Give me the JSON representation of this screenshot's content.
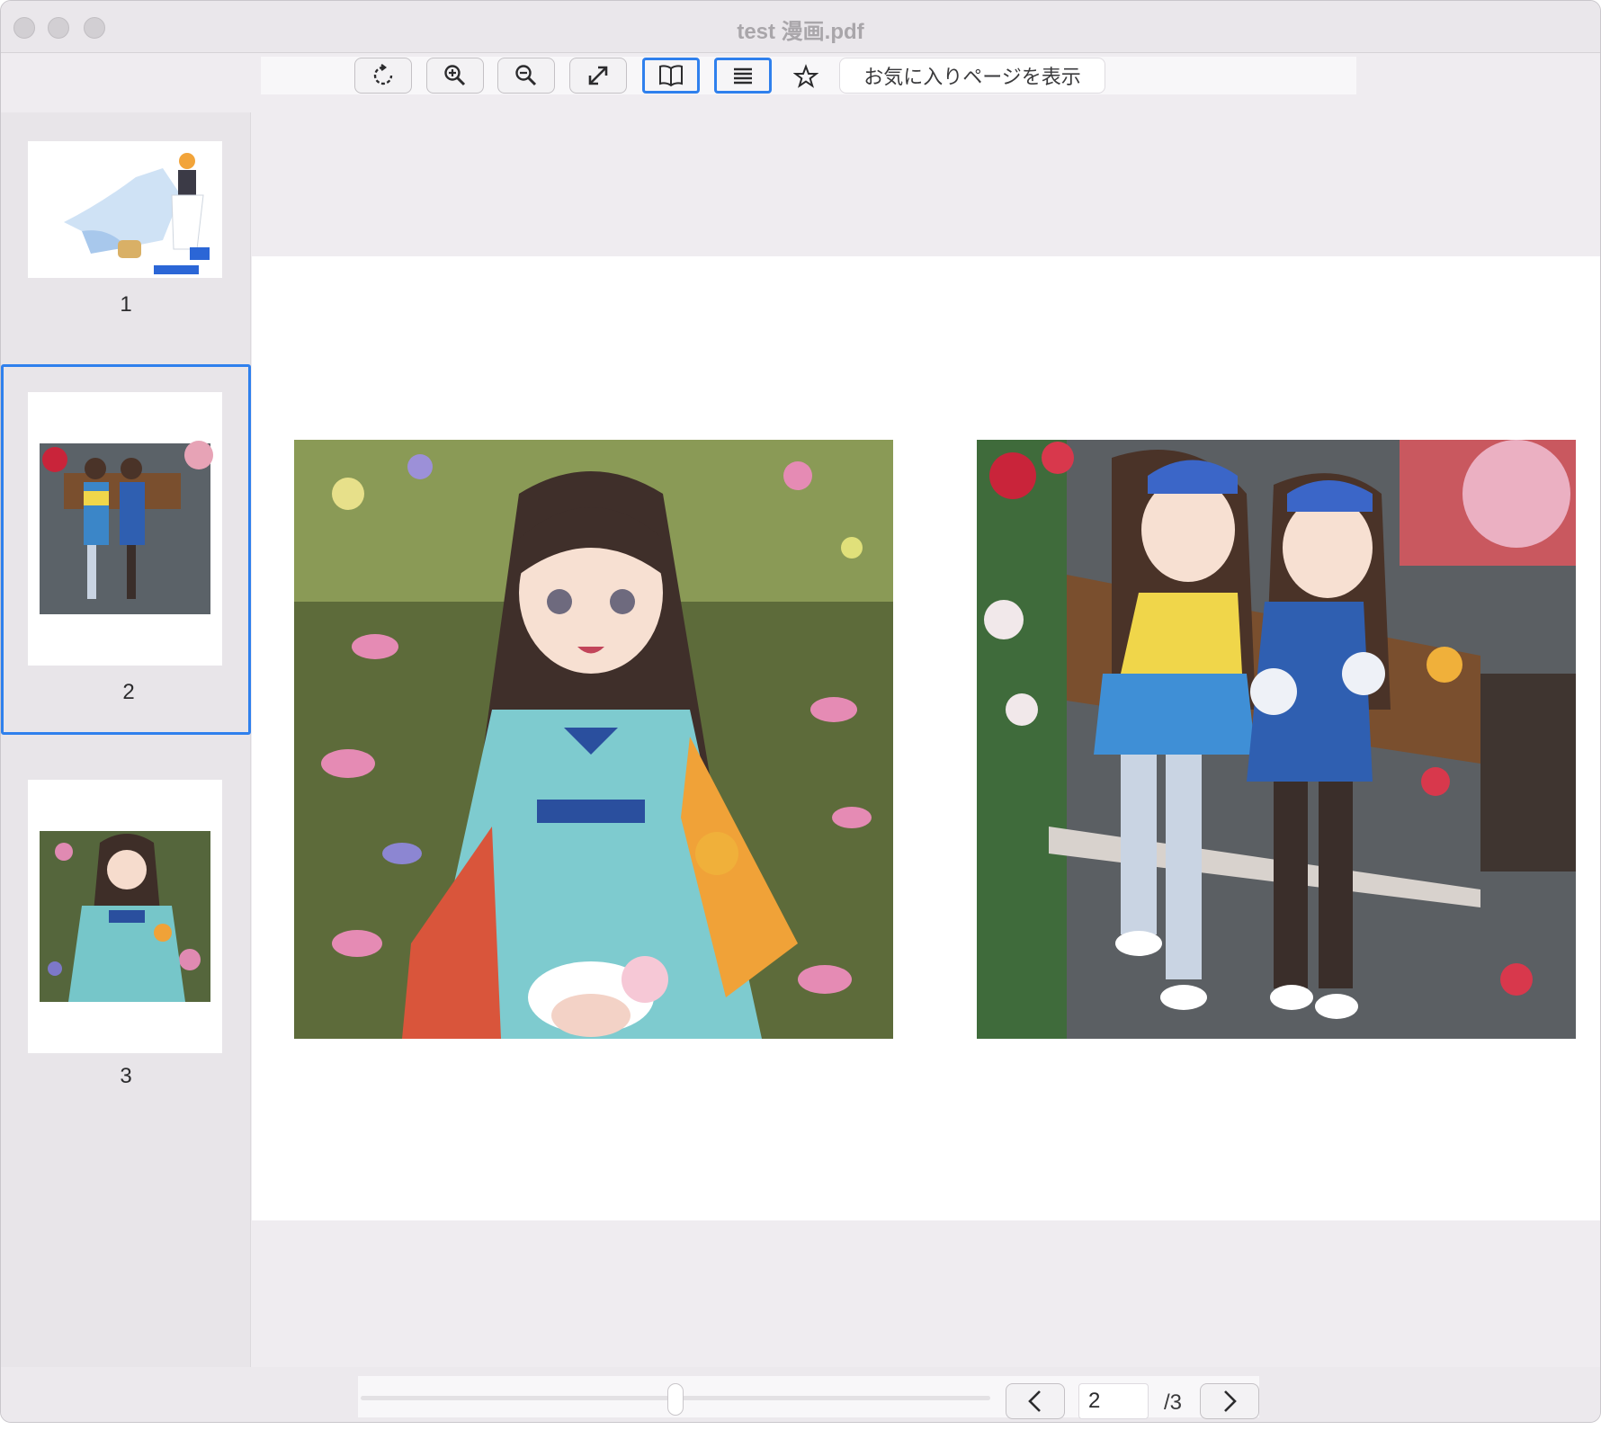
{
  "window": {
    "title": "test 漫画.pdf"
  },
  "toolbar": {
    "buttons": [
      {
        "name": "rotate",
        "icon": "rotate-icon"
      },
      {
        "name": "zoom-in",
        "icon": "zoom-in-icon"
      },
      {
        "name": "zoom-out",
        "icon": "zoom-out-icon"
      },
      {
        "name": "fit",
        "icon": "expand-icon"
      },
      {
        "name": "book-view",
        "icon": "book-icon",
        "active": true
      },
      {
        "name": "list-view",
        "icon": "list-icon",
        "active": true
      }
    ],
    "favorite_icon": "star-icon",
    "show_favorites_label": "お気に入りページを表示"
  },
  "sidebar": {
    "thumbnails": [
      {
        "page": "1",
        "selected": false
      },
      {
        "page": "2",
        "selected": true
      },
      {
        "page": "3",
        "selected": false
      }
    ]
  },
  "navigation": {
    "current_page": "2",
    "total_label": "/3",
    "prev_icon": "chevron-left-icon",
    "next_icon": "chevron-right-icon",
    "slider_fraction": 0.5
  },
  "colors": {
    "accent": "#2f80ed",
    "window_bg": "#efecf0"
  }
}
